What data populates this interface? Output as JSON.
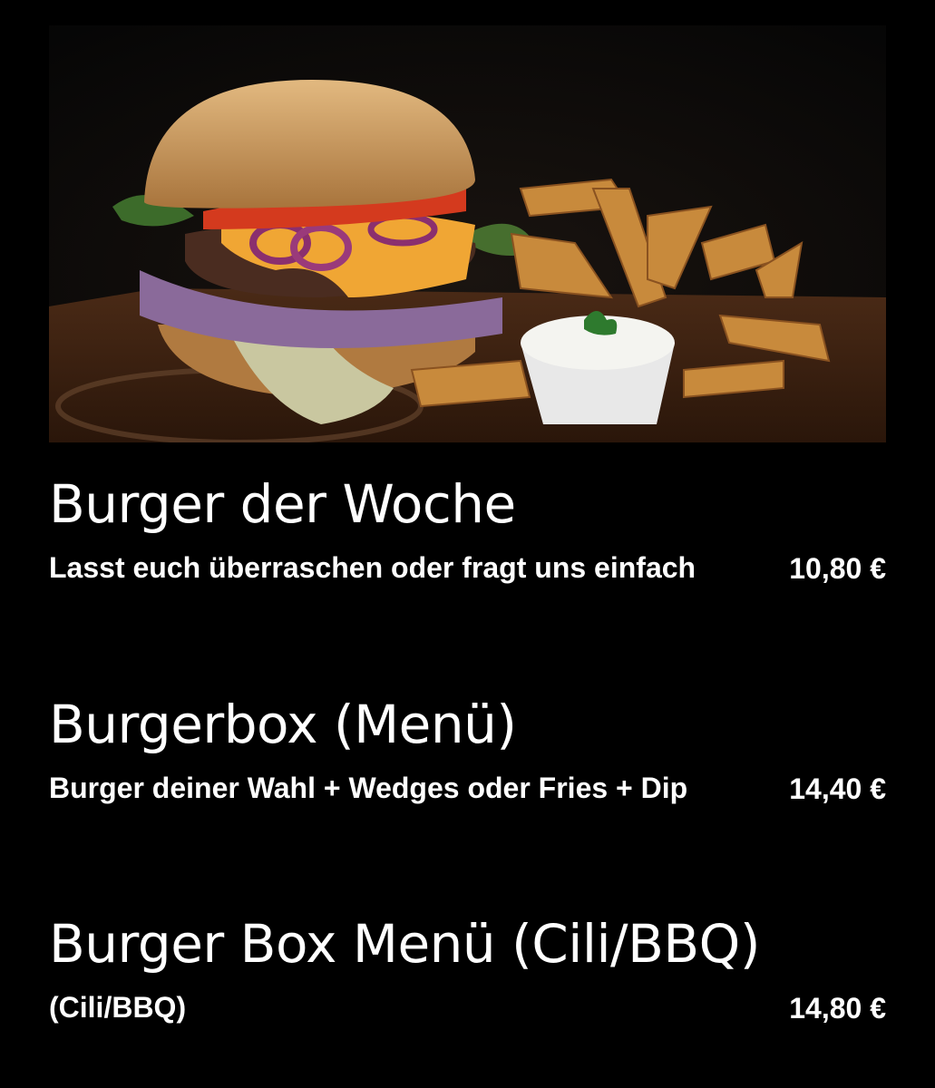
{
  "hero": {
    "image": "burger-with-wedges-and-dip-photo"
  },
  "items": [
    {
      "title": "Burger der Woche",
      "description": "Lasst euch überraschen oder fragt uns einfach",
      "price": "10,80 €"
    },
    {
      "title": "Burgerbox (Menü)",
      "description": "Burger deiner Wahl + Wedges oder Fries + Dip",
      "price": "14,40 €"
    },
    {
      "title": "Burger Box Menü (Cili/BBQ)",
      "description": "(Cili/BBQ)",
      "price": "14,80 €"
    }
  ]
}
